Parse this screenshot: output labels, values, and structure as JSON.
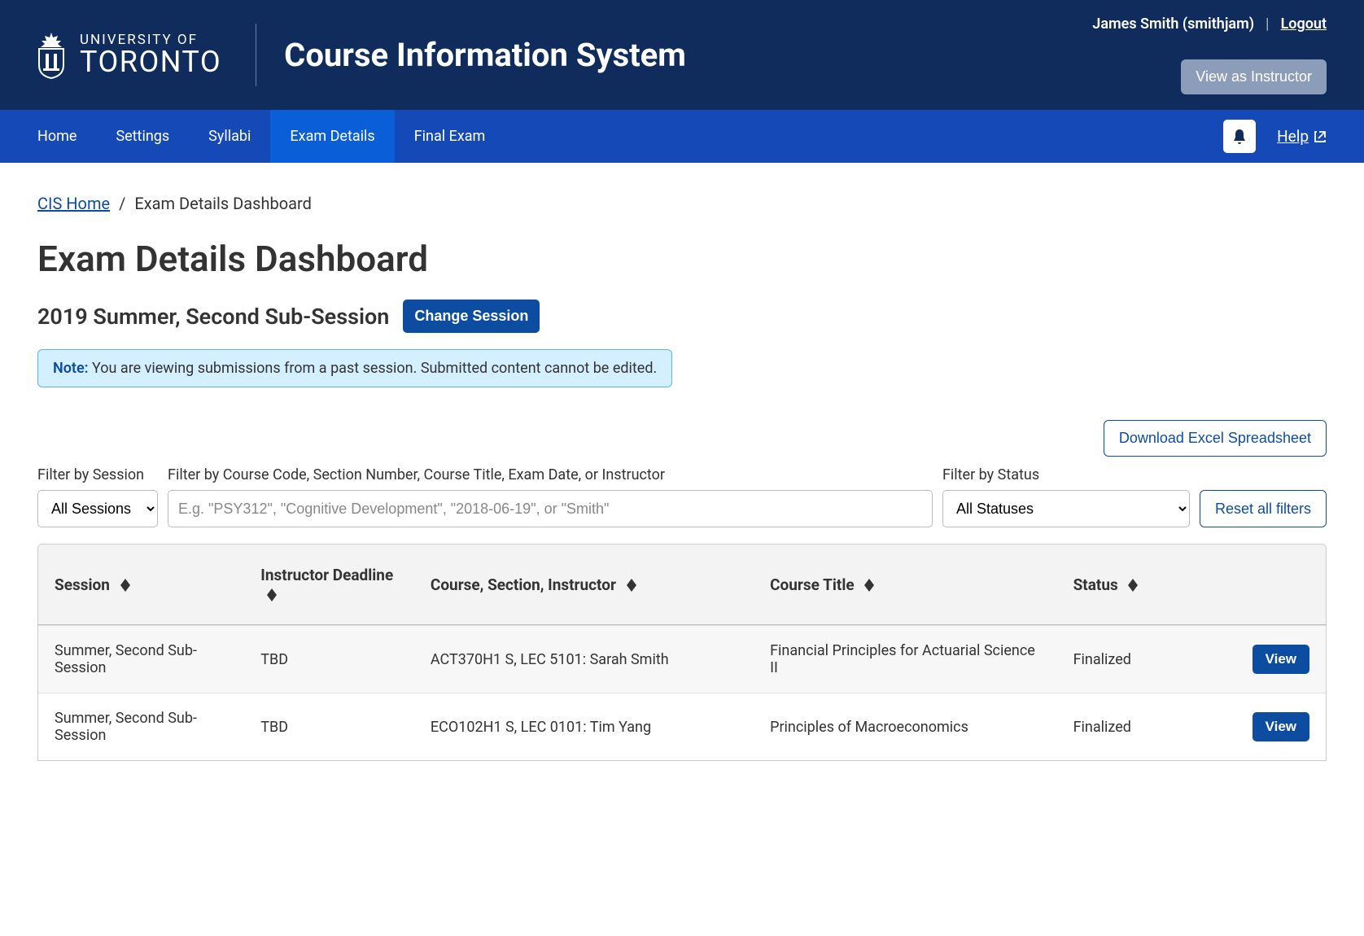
{
  "header": {
    "uoft_small": "UNIVERSITY OF",
    "uoft_large": "TORONTO",
    "app_title": "Course Information System",
    "user_name": "James Smith (smithjam)",
    "logout": "Logout",
    "view_as": "View as Instructor"
  },
  "nav": {
    "items": [
      {
        "label": "Home"
      },
      {
        "label": "Settings"
      },
      {
        "label": "Syllabi"
      },
      {
        "label": "Exam Details"
      },
      {
        "label": "Final Exam"
      }
    ],
    "help": "Help"
  },
  "breadcrumb": {
    "home": "CIS Home",
    "current": "Exam Details Dashboard"
  },
  "page": {
    "title": "Exam Details Dashboard",
    "session": "2019 Summer, Second Sub-Session",
    "change_session": "Change Session",
    "note_label": "Note:",
    "note_text": " You are viewing submissions from a past session. Submitted content cannot be edited.",
    "download": "Download Excel Spreadsheet",
    "reset_filters": "Reset all filters"
  },
  "filters": {
    "session_label": "Filter by Session",
    "session_value": "All Sessions",
    "search_label": "Filter by Course Code, Section Number, Course Title, Exam Date, or Instructor",
    "search_placeholder": "E.g. \"PSY312\", \"Cognitive Development\", \"2018-06-19\", or \"Smith\"",
    "status_label": "Filter by Status",
    "status_value": "All Statuses"
  },
  "table": {
    "headers": {
      "session": "Session",
      "deadline": "Instructor Deadline",
      "course": "Course, Section, Instructor",
      "title": "Course Title",
      "status": "Status"
    },
    "view_label": "View",
    "rows": [
      {
        "session": "Summer, Second Sub-Session",
        "deadline": "TBD",
        "course": "ACT370H1 S, LEC 5101: Sarah Smith",
        "title": "Financial Principles for Actuarial Science II",
        "status": "Finalized"
      },
      {
        "session": "Summer, Second Sub-Session",
        "deadline": "TBD",
        "course": "ECO102H1 S, LEC 0101: Tim Yang",
        "title": "Principles of Macroeconomics",
        "status": "Finalized"
      }
    ]
  }
}
